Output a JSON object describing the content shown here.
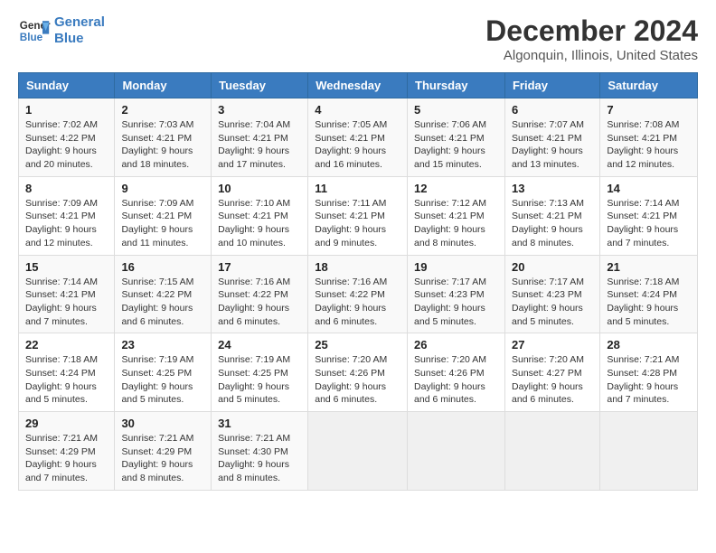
{
  "header": {
    "logo_line1": "General",
    "logo_line2": "Blue",
    "title": "December 2024",
    "subtitle": "Algonquin, Illinois, United States"
  },
  "weekdays": [
    "Sunday",
    "Monday",
    "Tuesday",
    "Wednesday",
    "Thursday",
    "Friday",
    "Saturday"
  ],
  "weeks": [
    [
      {
        "day": "1",
        "sunrise": "7:02 AM",
        "sunset": "4:22 PM",
        "daylight": "9 hours and 20 minutes."
      },
      {
        "day": "2",
        "sunrise": "7:03 AM",
        "sunset": "4:21 PM",
        "daylight": "9 hours and 18 minutes."
      },
      {
        "day": "3",
        "sunrise": "7:04 AM",
        "sunset": "4:21 PM",
        "daylight": "9 hours and 17 minutes."
      },
      {
        "day": "4",
        "sunrise": "7:05 AM",
        "sunset": "4:21 PM",
        "daylight": "9 hours and 16 minutes."
      },
      {
        "day": "5",
        "sunrise": "7:06 AM",
        "sunset": "4:21 PM",
        "daylight": "9 hours and 15 minutes."
      },
      {
        "day": "6",
        "sunrise": "7:07 AM",
        "sunset": "4:21 PM",
        "daylight": "9 hours and 13 minutes."
      },
      {
        "day": "7",
        "sunrise": "7:08 AM",
        "sunset": "4:21 PM",
        "daylight": "9 hours and 12 minutes."
      }
    ],
    [
      {
        "day": "8",
        "sunrise": "7:09 AM",
        "sunset": "4:21 PM",
        "daylight": "9 hours and 12 minutes."
      },
      {
        "day": "9",
        "sunrise": "7:09 AM",
        "sunset": "4:21 PM",
        "daylight": "9 hours and 11 minutes."
      },
      {
        "day": "10",
        "sunrise": "7:10 AM",
        "sunset": "4:21 PM",
        "daylight": "9 hours and 10 minutes."
      },
      {
        "day": "11",
        "sunrise": "7:11 AM",
        "sunset": "4:21 PM",
        "daylight": "9 hours and 9 minutes."
      },
      {
        "day": "12",
        "sunrise": "7:12 AM",
        "sunset": "4:21 PM",
        "daylight": "9 hours and 8 minutes."
      },
      {
        "day": "13",
        "sunrise": "7:13 AM",
        "sunset": "4:21 PM",
        "daylight": "9 hours and 8 minutes."
      },
      {
        "day": "14",
        "sunrise": "7:14 AM",
        "sunset": "4:21 PM",
        "daylight": "9 hours and 7 minutes."
      }
    ],
    [
      {
        "day": "15",
        "sunrise": "7:14 AM",
        "sunset": "4:21 PM",
        "daylight": "9 hours and 7 minutes."
      },
      {
        "day": "16",
        "sunrise": "7:15 AM",
        "sunset": "4:22 PM",
        "daylight": "9 hours and 6 minutes."
      },
      {
        "day": "17",
        "sunrise": "7:16 AM",
        "sunset": "4:22 PM",
        "daylight": "9 hours and 6 minutes."
      },
      {
        "day": "18",
        "sunrise": "7:16 AM",
        "sunset": "4:22 PM",
        "daylight": "9 hours and 6 minutes."
      },
      {
        "day": "19",
        "sunrise": "7:17 AM",
        "sunset": "4:23 PM",
        "daylight": "9 hours and 5 minutes."
      },
      {
        "day": "20",
        "sunrise": "7:17 AM",
        "sunset": "4:23 PM",
        "daylight": "9 hours and 5 minutes."
      },
      {
        "day": "21",
        "sunrise": "7:18 AM",
        "sunset": "4:24 PM",
        "daylight": "9 hours and 5 minutes."
      }
    ],
    [
      {
        "day": "22",
        "sunrise": "7:18 AM",
        "sunset": "4:24 PM",
        "daylight": "9 hours and 5 minutes."
      },
      {
        "day": "23",
        "sunrise": "7:19 AM",
        "sunset": "4:25 PM",
        "daylight": "9 hours and 5 minutes."
      },
      {
        "day": "24",
        "sunrise": "7:19 AM",
        "sunset": "4:25 PM",
        "daylight": "9 hours and 5 minutes."
      },
      {
        "day": "25",
        "sunrise": "7:20 AM",
        "sunset": "4:26 PM",
        "daylight": "9 hours and 6 minutes."
      },
      {
        "day": "26",
        "sunrise": "7:20 AM",
        "sunset": "4:26 PM",
        "daylight": "9 hours and 6 minutes."
      },
      {
        "day": "27",
        "sunrise": "7:20 AM",
        "sunset": "4:27 PM",
        "daylight": "9 hours and 6 minutes."
      },
      {
        "day": "28",
        "sunrise": "7:21 AM",
        "sunset": "4:28 PM",
        "daylight": "9 hours and 7 minutes."
      }
    ],
    [
      {
        "day": "29",
        "sunrise": "7:21 AM",
        "sunset": "4:29 PM",
        "daylight": "9 hours and 7 minutes."
      },
      {
        "day": "30",
        "sunrise": "7:21 AM",
        "sunset": "4:29 PM",
        "daylight": "9 hours and 8 minutes."
      },
      {
        "day": "31",
        "sunrise": "7:21 AM",
        "sunset": "4:30 PM",
        "daylight": "9 hours and 8 minutes."
      },
      null,
      null,
      null,
      null
    ]
  ],
  "labels": {
    "sunrise": "Sunrise:",
    "sunset": "Sunset:",
    "daylight": "Daylight:"
  }
}
